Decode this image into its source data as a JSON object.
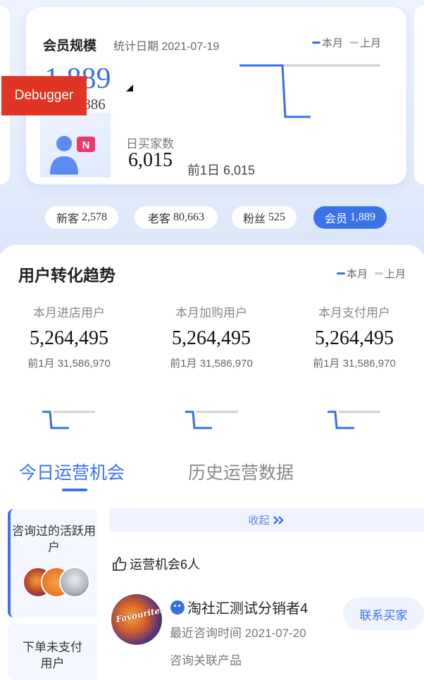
{
  "overlay": {
    "debugger_label": "Debugger"
  },
  "member_card": {
    "title": "会员规模",
    "date_label": "统计日期",
    "date": "2021-07-19",
    "legend": {
      "current": "本月",
      "previous": "上月"
    },
    "member_count": "1,889",
    "member_count_sub": ",886",
    "daily_buyers_label": "日买家数",
    "daily_buyers_value": "6,015",
    "daily_buyers_prev": "前1日 6,015",
    "badge_letter": "N",
    "colors": {
      "accent": "#3a6fe0",
      "badge": "#e8386c"
    }
  },
  "segments": [
    {
      "label": "新客",
      "value": "2,578",
      "active": false
    },
    {
      "label": "老客",
      "value": "80,663",
      "active": false
    },
    {
      "label": "粉丝",
      "value": "525",
      "active": false
    },
    {
      "label": "会员",
      "value": "1,889",
      "active": true
    }
  ],
  "conversion": {
    "title": "用户转化趋势",
    "legend": {
      "current": "本月",
      "previous": "上月"
    },
    "metrics": [
      {
        "label": "本月进店用户",
        "value": "5,264,495",
        "prev": "前1月 31,586,970"
      },
      {
        "label": "本月加购用户",
        "value": "5,264,495",
        "prev": "前1月 31,586,970"
      },
      {
        "label": "本月支付用户",
        "value": "5,264,495",
        "prev": "前1月 31,586,970"
      }
    ]
  },
  "tabs": [
    {
      "label": "今日运营机会",
      "active": true
    },
    {
      "label": "历史运营数据",
      "active": false
    }
  ],
  "side_categories": [
    {
      "label": "咨询过的活跃用户"
    },
    {
      "label": "下单未支付用户"
    }
  ],
  "collapse_label": "收起",
  "opportunity_text": "运营机会6人",
  "buyer": {
    "name": "淘社汇测试分销者4",
    "time_label": "最近咨询时间",
    "time": "2021-07-20",
    "product_label": "咨询关联产品",
    "avatar_text": "Favourites",
    "contact_label": "联系买家"
  }
}
